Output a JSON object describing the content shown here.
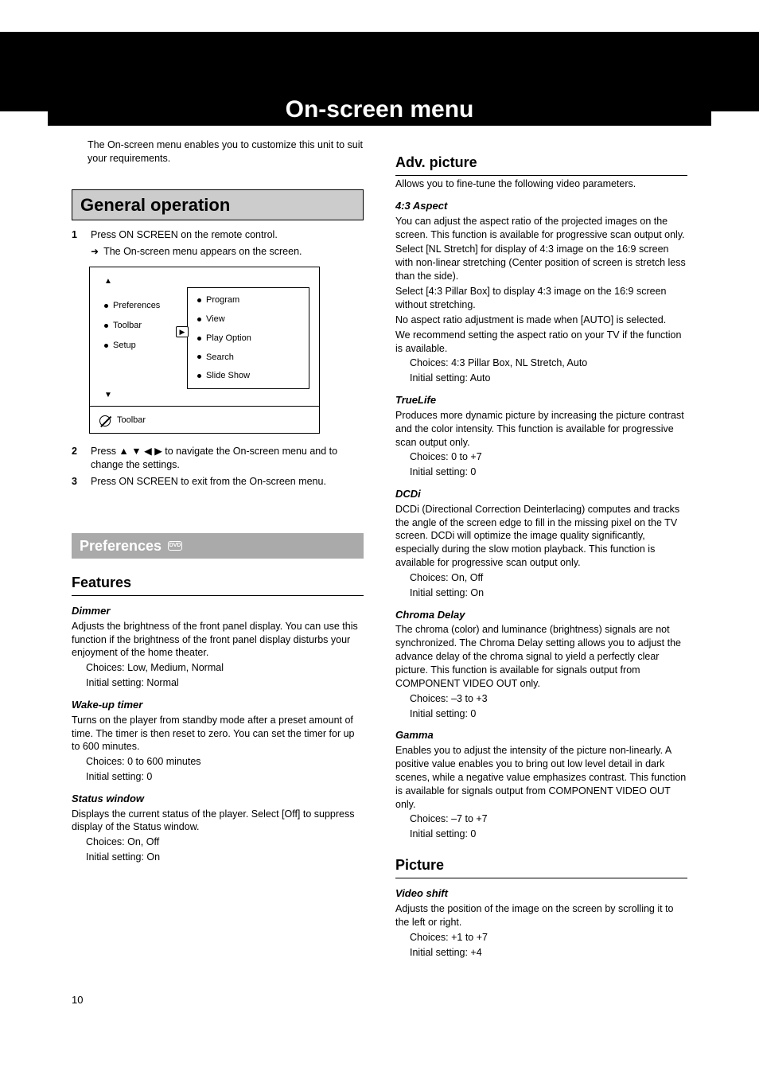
{
  "page_title": "On-screen menu",
  "intro": "The On-screen menu enables you to customize this unit to suit your requirements.",
  "general_operation": {
    "heading": "General operation",
    "steps": [
      {
        "num": "1",
        "text": "Press ON SCREEN on the remote control."
      },
      {
        "num": "2",
        "text": "Press ▲ ▼ ◀ ▶ to navigate the On-screen menu and to change the settings."
      },
      {
        "num": "3",
        "text": "Press ON SCREEN to exit from the On-screen menu."
      }
    ],
    "arrow_note": "The On-screen menu appears on the screen.",
    "menu": {
      "left": [
        "Preferences",
        "Toolbar",
        "Setup"
      ],
      "right": [
        "Program",
        "View",
        "Play Option",
        "Search",
        "Slide Show"
      ],
      "footer_label": "Toolbar"
    }
  },
  "preferences": {
    "heading": "Preferences",
    "features": {
      "heading": "Features",
      "dimmer": {
        "heading": "Dimmer",
        "body": "Adjusts the brightness of the front panel display. You can use this function if the brightness of the front panel display disturbs your enjoyment of the home theater.",
        "choices": "Choices: Low, Medium, Normal",
        "initial": "Initial setting: Normal"
      },
      "wake": {
        "heading": "Wake-up timer",
        "body": "Turns on the player from standby mode after a preset amount of time. The timer is then reset to zero. You can set the timer for up to 600 minutes.",
        "choices": "Choices: 0 to 600 minutes",
        "initial": "Initial setting: 0"
      },
      "status": {
        "heading": "Status window",
        "body": "Displays the current status of the player. Select [Off] to suppress display of the Status window.",
        "choices": "Choices: On, Off",
        "initial": "Initial setting: On"
      }
    }
  },
  "adv_picture": {
    "heading": "Adv. picture",
    "intro": "Allows you to fine-tune the following video parameters.",
    "aspect": {
      "heading": "4:3 Aspect",
      "p1": "You can adjust the aspect ratio of the projected images on the screen. This function is available for progressive scan output only.",
      "p2": "Select [NL Stretch] for display of 4:3 image on the 16:9 screen with non-linear stretching (Center position of screen is stretch less than the side).",
      "p3": "Select [4:3 Pillar Box] to display 4:3 image on the 16:9 screen without stretching.",
      "p4": "No aspect ratio adjustment is made when [AUTO] is selected.",
      "p5": "We recommend setting the aspect ratio on your TV if the function is available.",
      "choices": "Choices: 4:3 Pillar Box, NL Stretch, Auto",
      "initial": "Initial setting: Auto"
    },
    "truelife": {
      "heading": "TrueLife",
      "body": "Produces more dynamic picture by increasing the picture contrast and the color intensity. This function is available for progressive scan output only.",
      "choices": "Choices: 0 to +7",
      "initial": "Initial setting: 0"
    },
    "dcdi": {
      "heading": "DCDi",
      "body": "DCDi (Directional Correction Deinterlacing) computes and tracks the angle of the screen edge to fill in the missing pixel on the TV screen. DCDi will optimize the image quality significantly, especially during the slow motion playback. This function is available for progressive scan output only.",
      "choices": "Choices: On, Off",
      "initial": "Initial setting: On"
    },
    "chroma": {
      "heading": "Chroma Delay",
      "body": "The chroma (color) and luminance (brightness) signals are not synchronized. The Chroma Delay setting allows you to adjust the advance delay of the chroma signal to yield a perfectly clear picture. This function is available for signals output from COMPONENT VIDEO OUT only.",
      "choices": "Choices: –3 to +3",
      "initial": "Initial setting: 0"
    },
    "gamma": {
      "heading": "Gamma",
      "body": "Enables you to adjust the intensity of the picture non-linearly. A positive value enables you to bring out low level detail in dark scenes, while a negative value emphasizes contrast. This function is available for signals output from COMPONENT VIDEO OUT only.",
      "choices": "Choices: –7 to +7",
      "initial": "Initial setting: 0"
    }
  },
  "picture": {
    "heading": "Picture",
    "video_shift": {
      "heading": "Video shift",
      "body": "Adjusts the position of the image on the screen by scrolling it to the left or right.",
      "choices": "Choices: +1 to +7",
      "initial": "Initial setting: +4"
    }
  },
  "page_number": "10"
}
